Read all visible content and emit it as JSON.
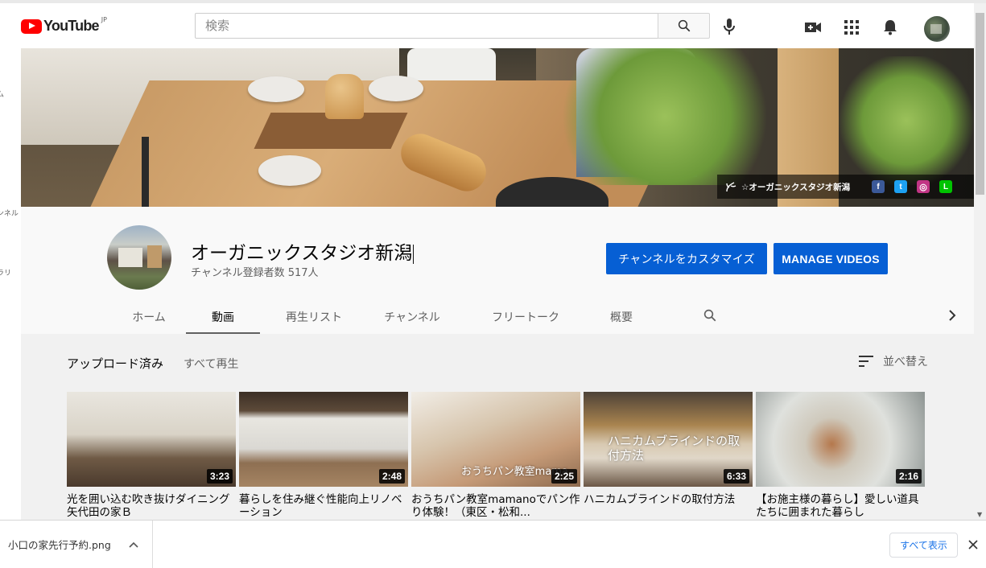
{
  "masthead": {
    "logo_text": "YouTube",
    "logo_region": "JP",
    "search_placeholder": "検索"
  },
  "guide_fragments": [
    "ム",
    "ンネル",
    "ラリ"
  ],
  "banner": {
    "link_text": "☆オーガニックスタジオ新潟",
    "social": [
      {
        "name": "facebook",
        "glyph": "f",
        "color": "#3b5998"
      },
      {
        "name": "twitter",
        "glyph": "t",
        "color": "#1da1f2"
      },
      {
        "name": "instagram",
        "glyph": "◎",
        "color": "#c13584"
      },
      {
        "name": "line",
        "glyph": "L",
        "color": "#00c300"
      }
    ]
  },
  "channel": {
    "title": "オーガニックスタジオ新潟",
    "subscribers": "チャンネル登録者数 517人",
    "customize_label": "チャンネルをカスタマイズ",
    "manage_label": "MANAGE VIDEOS"
  },
  "tabs": [
    {
      "label": "ホーム",
      "active": false
    },
    {
      "label": "動画",
      "active": true
    },
    {
      "label": "再生リスト",
      "active": false
    },
    {
      "label": "チャンネル",
      "active": false
    },
    {
      "label": "フリートーク",
      "active": false
    },
    {
      "label": "概要",
      "active": false
    }
  ],
  "shelf": {
    "title": "アップロード済み",
    "play_all": "すべて再生",
    "sort_label": "並べ替え"
  },
  "videos": [
    {
      "title": "光を囲い込む吹き抜けダイニング矢代田の家Ｂ",
      "duration": "3:23",
      "overlay": ""
    },
    {
      "title": "暮らしを住み継ぐ性能向上リノベーション",
      "duration": "2:48",
      "overlay": ""
    },
    {
      "title": "おうちパン教室mamanoでパン作り体験！（東区・松和...",
      "duration": "2:25",
      "overlay": "おうちパン教室mama"
    },
    {
      "title": "ハニカムブラインドの取付方法",
      "duration": "6:33",
      "overlay": "ハニカムブラインドの取付方法"
    },
    {
      "title": "【お施主様の暮らし】愛しい道具たちに囲まれた暮らし",
      "duration": "2:16",
      "overlay": ""
    }
  ],
  "download_bar": {
    "filename": "小口の家先行予約.png",
    "show_all": "すべて表示"
  }
}
